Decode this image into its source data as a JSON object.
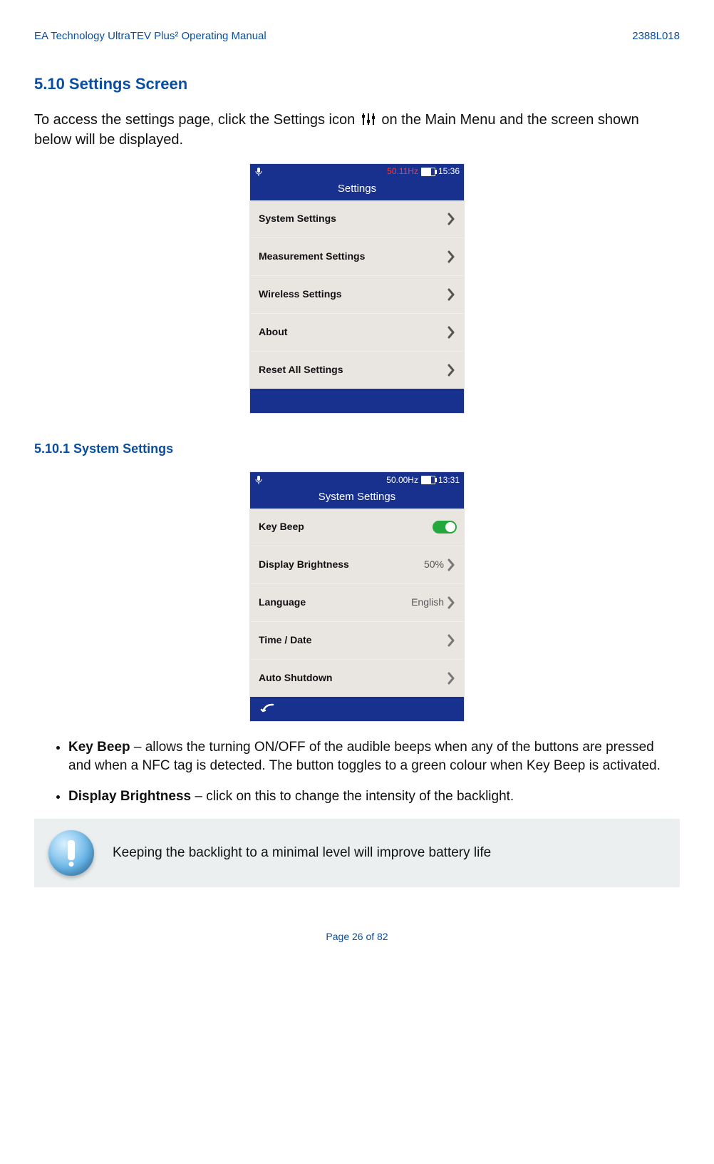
{
  "doc_header": {
    "left": "EA Technology UltraTEV Plus² Operating Manual",
    "right": "2388L018"
  },
  "sec510_heading": "5.10  Settings Screen",
  "intro_prefix": "To access the settings page, click the Settings icon ",
  "intro_suffix": "  on the Main Menu and the screen shown below will be displayed.",
  "settings_screen": {
    "hz": "50.11Hz",
    "time": "15:36",
    "title": "Settings",
    "items": [
      {
        "label": "System Settings"
      },
      {
        "label": "Measurement Settings"
      },
      {
        "label": "Wireless Settings"
      },
      {
        "label": "About"
      },
      {
        "label": "Reset All Settings"
      }
    ]
  },
  "sec5101_heading": "5.10.1 System Settings",
  "system_screen": {
    "hz": "50.00Hz",
    "time": "13:31",
    "title": "System Settings",
    "items": [
      {
        "label": "Key Beep",
        "toggle": true
      },
      {
        "label": "Display Brightness",
        "value": "50%"
      },
      {
        "label": "Language",
        "value": "English"
      },
      {
        "label": "Time / Date"
      },
      {
        "label": "Auto Shutdown"
      }
    ]
  },
  "bullets": {
    "keybeep_bold": "Key Beep",
    "keybeep_text": " – allows the turning ON/OFF of the audible beeps when any of the buttons are pressed and when a NFC tag is detected. The button toggles to a green colour when Key Beep is activated.",
    "brightness_bold": "Display Brightness",
    "brightness_text": " – click on this to change the intensity of the backlight."
  },
  "note_text": "Keeping the backlight to a minimal level will improve battery life",
  "page_footer": "Page 26 of 82"
}
